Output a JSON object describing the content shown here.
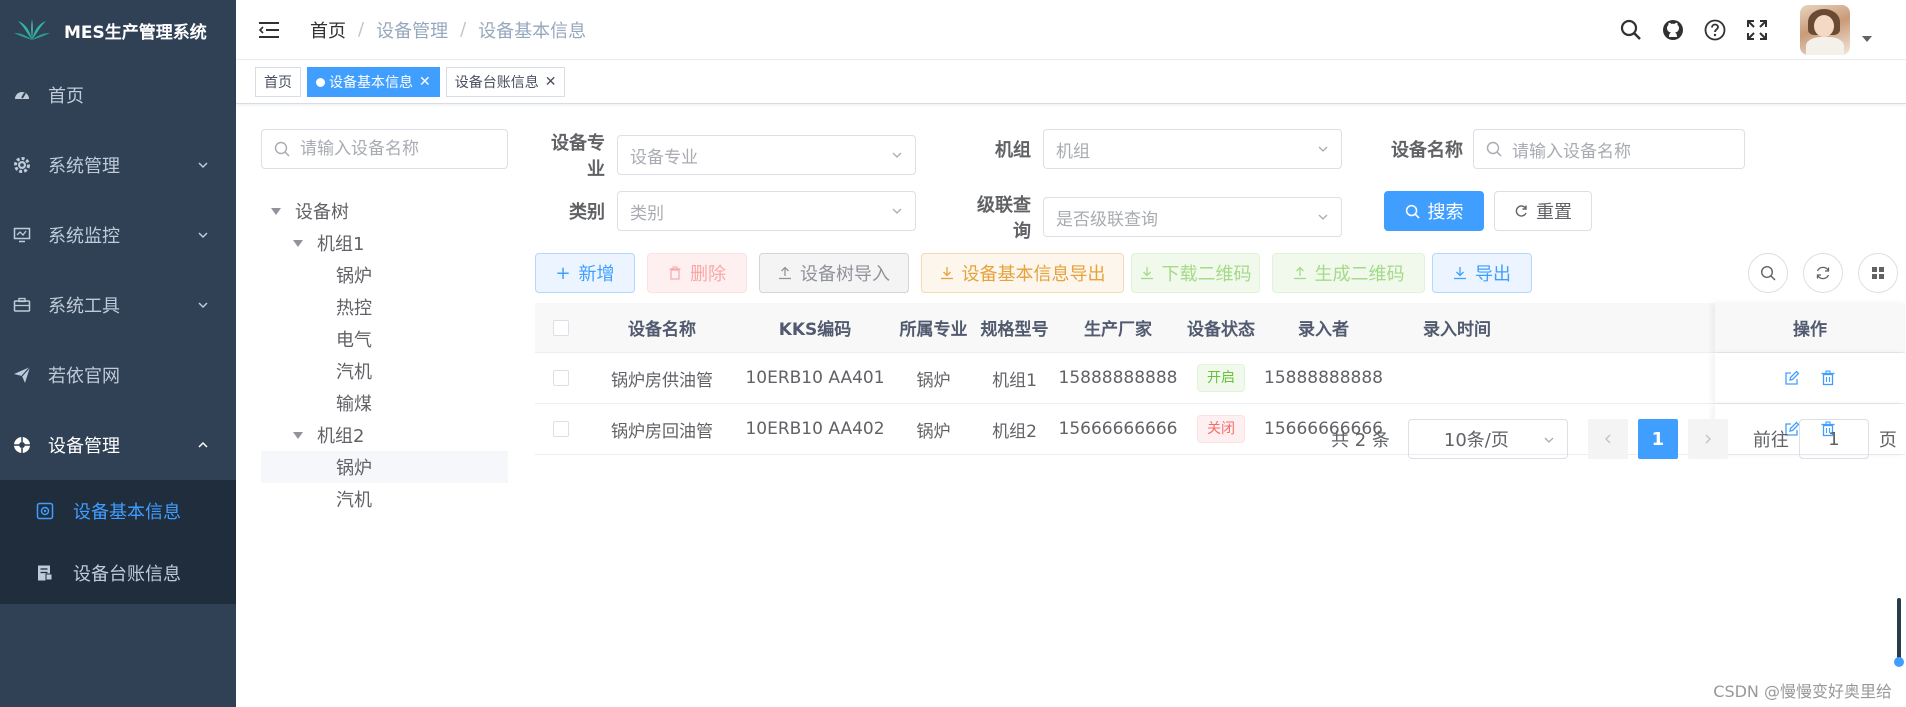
{
  "app": {
    "title": "MES生产管理系统"
  },
  "sidebar": {
    "items": [
      {
        "label": "首页",
        "icon": "dashboard-icon"
      },
      {
        "label": "系统管理",
        "icon": "gear-icon"
      },
      {
        "label": "系统监控",
        "icon": "monitor-icon"
      },
      {
        "label": "系统工具",
        "icon": "toolbox-icon"
      },
      {
        "label": "若依官网",
        "icon": "send-icon"
      },
      {
        "label": "设备管理",
        "icon": "equipment-icon"
      }
    ],
    "submenu": [
      {
        "label": "设备基本信息",
        "icon": "device-icon"
      },
      {
        "label": "设备台账信息",
        "icon": "ledger-icon"
      }
    ]
  },
  "breadcrumb": {
    "home": "首页",
    "section": "设备管理",
    "page": "设备基本信息",
    "separator": "/"
  },
  "tags": [
    {
      "label": "首页"
    },
    {
      "label": "设备基本信息"
    },
    {
      "label": "设备台账信息"
    }
  ],
  "tree": {
    "search_placeholder": "请输入设备名称",
    "root": "设备树",
    "group1": {
      "label": "机组1",
      "children": [
        "锅炉",
        "热控",
        "电气",
        "汽机",
        "输煤"
      ]
    },
    "group2": {
      "label": "机组2",
      "children": [
        "锅炉",
        "汽机"
      ]
    }
  },
  "filters": {
    "specialty_label": "设备专业",
    "specialty_placeholder": "设备专业",
    "unit_label": "机组",
    "unit_placeholder": "机组",
    "name_label": "设备名称",
    "name_placeholder": "请输入设备名称",
    "category_label": "类别",
    "category_placeholder": "类别",
    "cascade_label": "级联查询",
    "cascade_placeholder": "是否级联查询",
    "search_button": "搜索",
    "reset_button": "重置"
  },
  "toolbar": {
    "add": "新增",
    "delete": "删除",
    "tree_import": "设备树导入",
    "export_basic": "设备基本信息导出",
    "download_qr": "下载二维码",
    "generate_qr": "生成二维码",
    "export": "导出"
  },
  "table": {
    "columns": [
      "设备名称",
      "KKS编码",
      "所属专业",
      "规格型号",
      "生产厂家",
      "设备状态",
      "录入者",
      "录入时间",
      "操作"
    ],
    "rows": [
      {
        "name": "锅炉房供油管",
        "kks": "10ERB10 AA401",
        "specialty": "锅炉",
        "model": "机组1",
        "maker": "15888888888",
        "status": "开启",
        "creator": "15888888888"
      },
      {
        "name": "锅炉房回油管",
        "kks": "10ERB10 AA402",
        "specialty": "锅炉",
        "model": "机组2",
        "maker": "15666666666",
        "status": "关闭",
        "creator": "15666666666"
      }
    ]
  },
  "pagination": {
    "total": "共 2 条",
    "page_size": "10条/页",
    "current": "1",
    "goto_label": "前往",
    "goto_value": "1",
    "page_suffix": "页"
  },
  "watermark": "CSDN @慢慢变好奥里给",
  "colors": {
    "sidebar_bg": "#304156",
    "submenu_bg": "#1f2d3d",
    "primary": "#409eff"
  }
}
